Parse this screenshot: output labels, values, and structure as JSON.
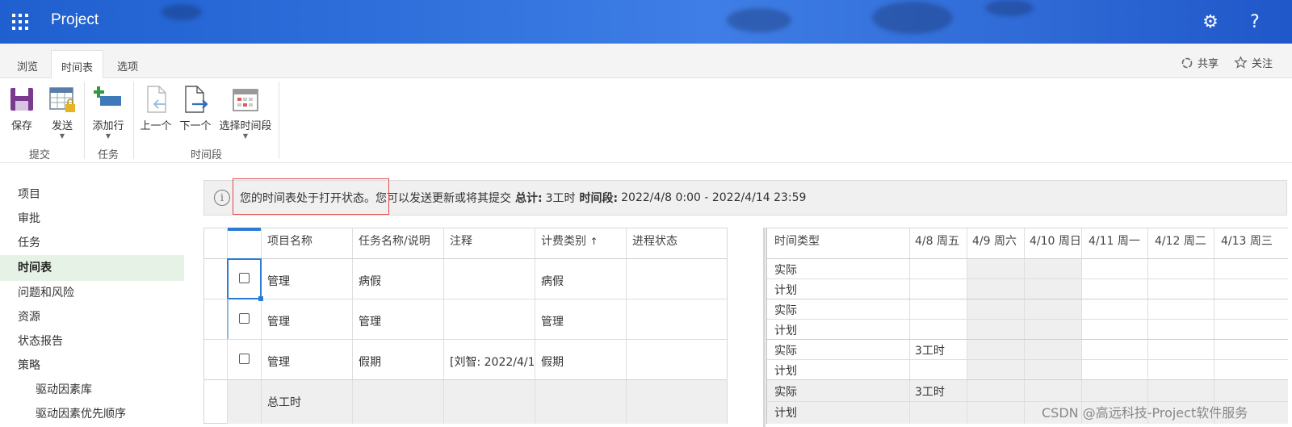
{
  "app": {
    "title": "Project"
  },
  "tabs": [
    "浏览",
    "时间表",
    "选项"
  ],
  "header_actions": {
    "share": "共享",
    "follow": "关注"
  },
  "ribbon": {
    "buttons": {
      "save": "保存",
      "send": "发送",
      "add_row": "添加行",
      "prev": "上一个",
      "next": "下一个",
      "select_period": "选择时间段"
    },
    "groups": {
      "submit": "提交",
      "task": "任务",
      "period": "时间段"
    }
  },
  "nav": {
    "items": [
      "项目",
      "审批",
      "任务",
      "时间表",
      "问题和风险",
      "资源",
      "状态报告",
      "策略"
    ],
    "sub_items": [
      "驱动因素库",
      "驱动因素优先顺序"
    ]
  },
  "status": {
    "message": "您的时间表处于打开状态。您可以发送更新或将其提交",
    "total_label": "总计:",
    "total_value": "3工时",
    "period_label": "时间段:",
    "period_value": "2022/4/8 0:00 - 2022/4/14 23:59"
  },
  "left_grid": {
    "headers": [
      "项目名称",
      "任务名称/说明",
      "注释",
      "计费类别",
      "进程状态"
    ],
    "sort_indicator": "↑",
    "rows": [
      {
        "project": "管理",
        "task": "病假",
        "note": "",
        "billing": "病假",
        "progress": ""
      },
      {
        "project": "管理",
        "task": "管理",
        "note": "",
        "billing": "管理",
        "progress": ""
      },
      {
        "project": "管理",
        "task": "假期",
        "note": "[刘智: 2022/4/1",
        "billing": "假期",
        "progress": ""
      }
    ],
    "total_label": "总工时"
  },
  "right_grid": {
    "type_header": "时间类型",
    "days": [
      "4/8 周五",
      "4/9 周六",
      "4/10 周日",
      "4/11 周一",
      "4/12 周二",
      "4/13 周三"
    ],
    "rows": [
      {
        "type": "实际",
        "first_day": ""
      },
      {
        "type": "计划",
        "first_day": ""
      },
      {
        "type": "实际",
        "first_day": ""
      },
      {
        "type": "计划",
        "first_day": ""
      },
      {
        "type": "实际",
        "first_day": "3工时"
      },
      {
        "type": "计划",
        "first_day": ""
      },
      {
        "type": "实际",
        "first_day": "3工时"
      },
      {
        "type": "计划",
        "first_day": ""
      }
    ]
  },
  "watermark": "CSDN @高远科技-Project软件服务"
}
